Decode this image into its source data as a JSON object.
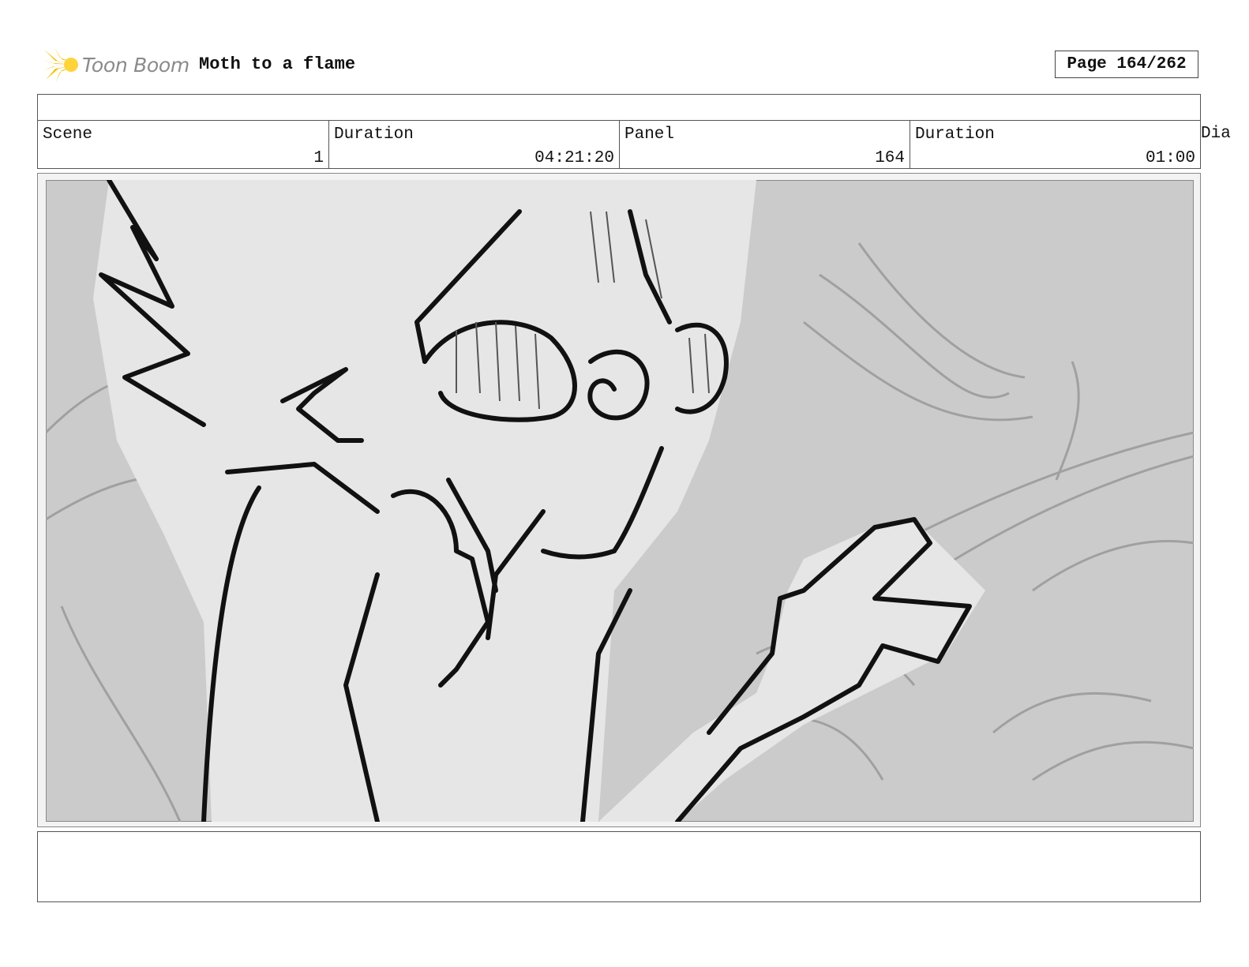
{
  "header": {
    "logo_text": "Toon Boom",
    "project_title": "Moth to a flame",
    "page_indicator": "Page 164/262"
  },
  "info": {
    "scene_label": "Scene",
    "scene_value": "1",
    "scene_duration_label": "Duration",
    "scene_duration_value": "04:21:20",
    "panel_label": "Panel",
    "panel_value": "164",
    "panel_duration_label": "Duration",
    "panel_duration_value": "01:00",
    "dialogue_label_truncated": "Dia"
  },
  "panel": {
    "image_icon": "storyboard-sketch-image",
    "colors": {
      "sky": "#cbcbcb",
      "character_fill": "#e6e6e6",
      "ink": "#111111",
      "faint_lines": "#a0a0a0"
    }
  },
  "colors": {
    "logo_yellow": "#f5c000",
    "logo_text_gray": "#8a8a8a",
    "border": "#555555"
  }
}
